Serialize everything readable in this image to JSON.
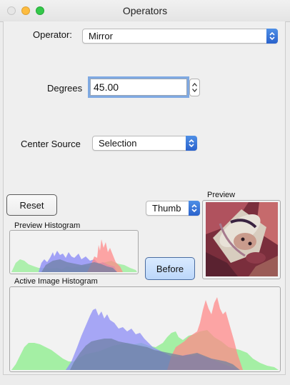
{
  "window": {
    "title": "Operators"
  },
  "operator": {
    "label": "Operator:",
    "value": "Mirror"
  },
  "degrees": {
    "label": "Degrees",
    "value": "45.00"
  },
  "center_source": {
    "label": "Center Source",
    "value": "Selection"
  },
  "buttons": {
    "reset": "Reset",
    "before": "Before"
  },
  "thumb_popup": {
    "value": "Thumb"
  },
  "preview": {
    "label": "Preview"
  },
  "histograms": {
    "preview_label": "Preview Histogram",
    "active_label": "Active Image Histogram",
    "colors": {
      "red": "#ff8a8a",
      "green": "#90ee90",
      "blue": "#8c8cf6",
      "overlap": "#6c7fa1"
    }
  },
  "icons": {
    "popup_arrows": "up-down-chevron-icon",
    "stepper": "stepper-arrows-icon"
  }
}
